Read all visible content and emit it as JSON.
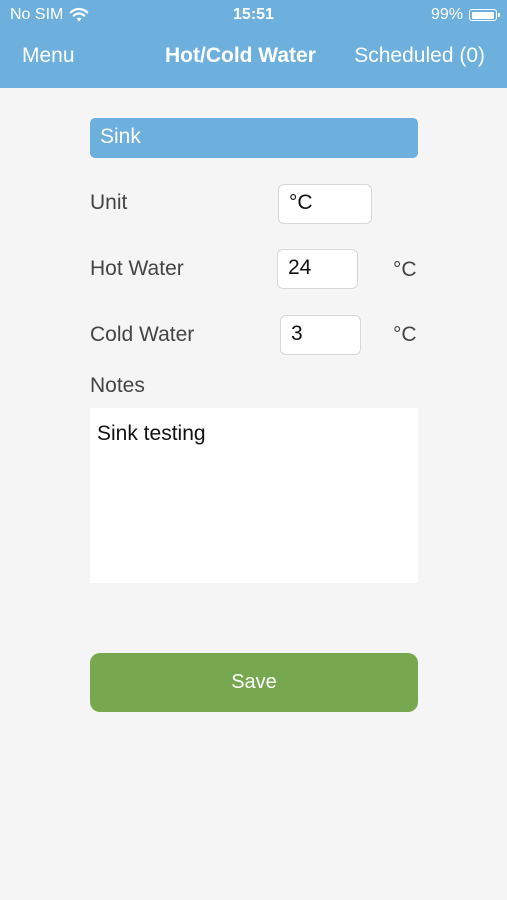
{
  "status_bar": {
    "carrier": "No SIM",
    "time": "15:51",
    "battery_percent": "99%",
    "battery_level": 0.99
  },
  "nav": {
    "menu_label": "Menu",
    "title": "Hot/Cold Water",
    "scheduled_label": "Scheduled (0)"
  },
  "form": {
    "section_title": "Sink",
    "unit_label": "Unit",
    "unit_value": "°C",
    "hot_label": "Hot Water",
    "hot_value": "24",
    "hot_unit": "°C",
    "cold_label": "Cold Water",
    "cold_value": "3",
    "cold_unit": "°C",
    "notes_label": "Notes",
    "notes_value": "Sink testing"
  },
  "actions": {
    "save_label": "Save"
  },
  "colors": {
    "header": "#6db0dd",
    "save_button": "#77a84f",
    "background": "#f5f5f5"
  },
  "icons": {
    "wifi": "wifi-icon",
    "battery": "battery-icon"
  }
}
